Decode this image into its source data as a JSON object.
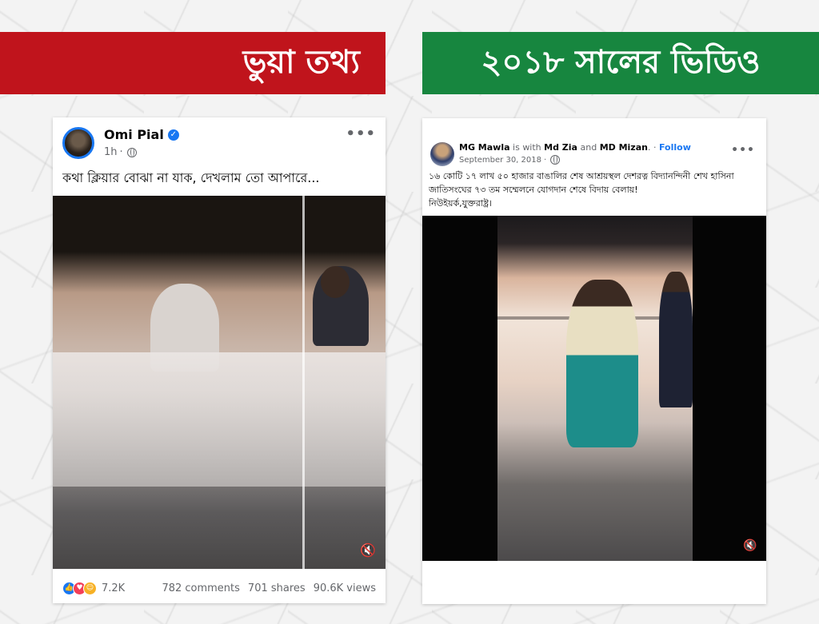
{
  "banners": {
    "left": "ভুয়া তথ্য",
    "right": "২০১৮ সালের ভিডিও"
  },
  "left_post": {
    "author": "Omi Pial",
    "time": "1h",
    "caption": "কথা ক্লিয়ার বোঝা না যাক, দেখলাম তো আপারে...",
    "reactions_count": "7.2K",
    "comments": "782 comments",
    "shares": "701 shares",
    "views": "90.6K views",
    "reaction_icons": [
      "like-icon",
      "love-icon",
      "care-icon"
    ],
    "accent": "#1877f2"
  },
  "right_post": {
    "author": "MG Mawla",
    "with_text": "is with",
    "tag1": "Md Zia",
    "and_text": "and",
    "tag2": "MD Mizan",
    "follow": "Follow",
    "date": "September 30, 2018",
    "caption_line1": "১৬ কোটি ১৭ লাখ ৫০ হাজার বাঙালির শেষ আশ্রয়স্থল দেশরত্ন বিদ্যানন্দিনী শেখ হাসিনা",
    "caption_line2": "জাতিসংঘের ৭৩ তম সম্মেলনে যোগদান শেষে বিদায় বেলায়!",
    "caption_line3": "নিউইয়র্ক,যুক্তরাষ্ট্র।"
  },
  "colors": {
    "banner_red": "#c0141c",
    "banner_green": "#17863f",
    "facebook_blue": "#1877f2"
  }
}
